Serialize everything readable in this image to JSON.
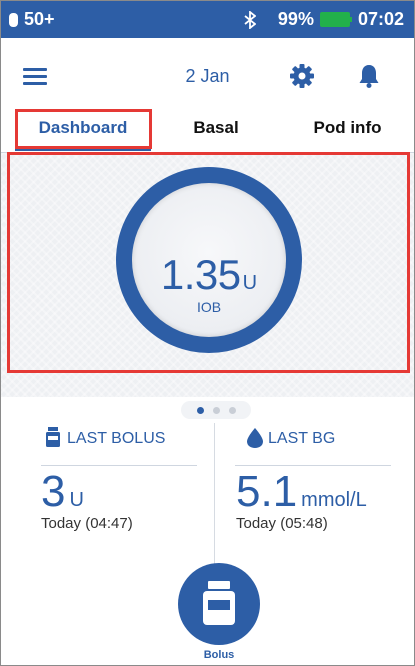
{
  "status_bar": {
    "pod_reservoir": "50+",
    "battery_percent": "99%",
    "time": "07:02",
    "icons": [
      "pod-icon",
      "bluetooth-icon",
      "battery-charging-icon"
    ]
  },
  "header": {
    "date": "2 Jan",
    "icons": [
      "menu-icon",
      "gear-icon",
      "bell-icon"
    ]
  },
  "tabs": [
    {
      "label": "Dashboard",
      "active": true
    },
    {
      "label": "Basal",
      "active": false
    },
    {
      "label": "Pod info",
      "active": false
    }
  ],
  "dashboard": {
    "iob_value": "1.35",
    "iob_unit": "U",
    "iob_label": "IOB"
  },
  "pager": {
    "count": 3,
    "active_index": 0
  },
  "last_bolus": {
    "title": "LAST BOLUS",
    "value": "3",
    "unit": "U",
    "time": "Today (04:47)"
  },
  "last_bg": {
    "title": "LAST BG",
    "value": "5.1",
    "unit": "mmol/L",
    "time": "Today (05:48)"
  },
  "bolus_button": {
    "label": "Bolus"
  },
  "colors": {
    "brand_blue": "#2d5ea6",
    "highlight_red": "#e53935",
    "battery_green": "#22b04b"
  }
}
